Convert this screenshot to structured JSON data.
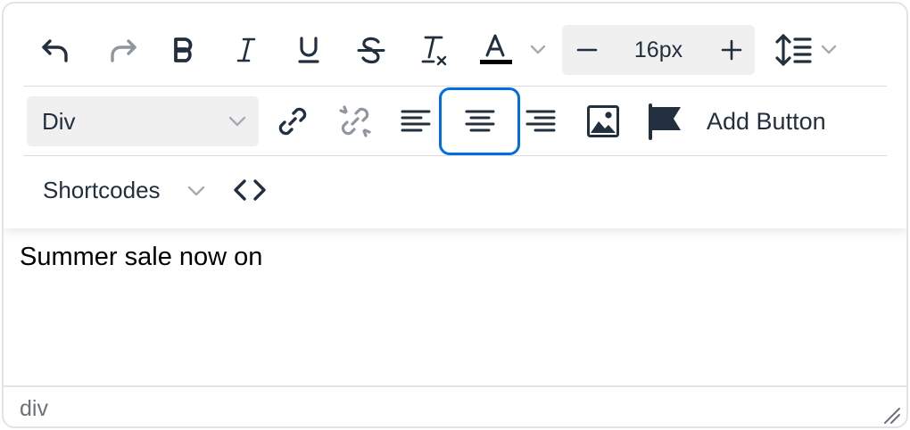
{
  "toolbar": {
    "row1": {
      "undo_icon": "undo-icon",
      "redo_icon": "redo-icon",
      "bold_icon": "bold-icon",
      "italic_icon": "italic-icon",
      "underline_icon": "underline-icon",
      "strikethrough_icon": "strikethrough-icon",
      "clear_format_icon": "remove-format-icon",
      "text_color_icon": "text-color-icon",
      "text_color_swatch": "#000000",
      "font_size": {
        "decrease_icon": "minus-icon",
        "value": "16px",
        "increase_icon": "plus-icon"
      },
      "line_height_icon": "line-height-icon"
    },
    "row2": {
      "block_format": {
        "value": "Div"
      },
      "link_icon": "link-icon",
      "unlink_icon": "unlink-icon",
      "align_left_icon": "align-left-icon",
      "align_center_icon": "align-center-icon",
      "align_right_icon": "align-right-icon",
      "image_icon": "image-icon",
      "anchor_icon": "flag-icon",
      "add_button_label": "Add Button"
    },
    "row3": {
      "shortcodes_label": "Shortcodes",
      "code_icon": "code-icon"
    }
  },
  "content": {
    "text": "Summer sale now on"
  },
  "statusbar": {
    "path": "div"
  },
  "colors": {
    "accent": "#006ce7",
    "icon": "#222f3e",
    "button_bg": "#f0f0f0",
    "disabled_icon": "#a6abb1"
  }
}
